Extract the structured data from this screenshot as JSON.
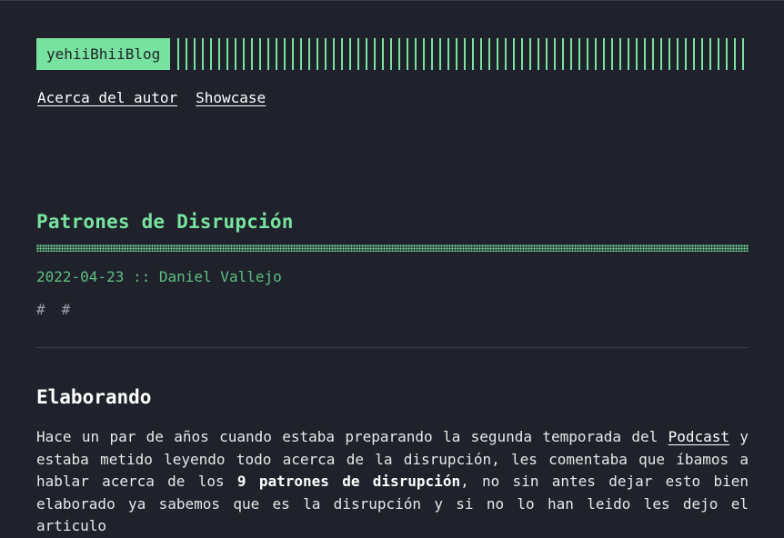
{
  "header": {
    "logo_text": "yehiiBhiiBlog"
  },
  "nav": {
    "items": [
      {
        "label": "Acerca del autor"
      },
      {
        "label": "Showcase"
      }
    ]
  },
  "post": {
    "title": "Patrones de Disrupción",
    "date": "2022-04-23",
    "separator": "::",
    "author": "Daniel Vallejo",
    "tags": [
      "#",
      "#"
    ],
    "section_heading": "Elaborando",
    "paragraph": {
      "part1": "Hace un par de años cuando estaba preparando la segunda temporada del ",
      "link_podcast": "Podcast",
      "part2": " y estaba metido leyendo todo acerca de la disrupción, les comentaba que íbamos a hablar acerca de los ",
      "bold": "9 patrones de disrupción",
      "part3": ", no sin antes dejar esto bien elaborado ya sabemos que es la disrupción y si no lo han leido les dejo el articulo"
    }
  },
  "colors": {
    "background": "#1f222a",
    "accent": "#78e2a0",
    "meta": "#5fbf83",
    "text": "#e8e8e8"
  }
}
